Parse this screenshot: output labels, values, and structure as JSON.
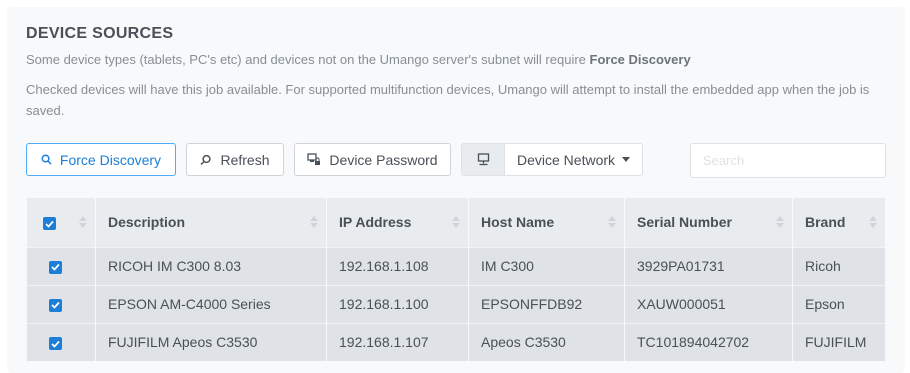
{
  "section": {
    "title": "DEVICE SOURCES",
    "note1_prefix": "Some device types (tablets, PC's etc) and devices not on the Umango server's subnet will require ",
    "note1_bold": "Force Discovery",
    "note2": "Checked devices will have this job available. For supported multifunction devices, Umango will attempt to install the embedded app when the job is saved."
  },
  "toolbar": {
    "force_discovery": "Force Discovery",
    "refresh": "Refresh",
    "device_password": "Device Password",
    "device_network": "Device Network",
    "search_placeholder": "Search"
  },
  "colors": {
    "accent": "#1c7ed6",
    "header_bg": "#e9ecef",
    "row_bg": "#dfe3e7"
  },
  "table": {
    "headers": {
      "description": "Description",
      "ip": "IP Address",
      "host": "Host Name",
      "serial": "Serial Number",
      "brand": "Brand"
    },
    "select_all_checked": true,
    "rows": [
      {
        "checked": true,
        "description": "RICOH IM C300 8.03",
        "ip": "192.168.1.108",
        "host": "IM C300",
        "serial": "3929PA01731",
        "brand": "Ricoh"
      },
      {
        "checked": true,
        "description": "EPSON AM-C4000 Series",
        "ip": "192.168.1.100",
        "host": "EPSONFFDB92",
        "serial": "XAUW000051",
        "brand": "Epson"
      },
      {
        "checked": true,
        "description": "FUJIFILM Apeos C3530",
        "ip": "192.168.1.107",
        "host": "Apeos C3530",
        "serial": "TC101894042702",
        "brand": "FUJIFILM"
      }
    ]
  }
}
